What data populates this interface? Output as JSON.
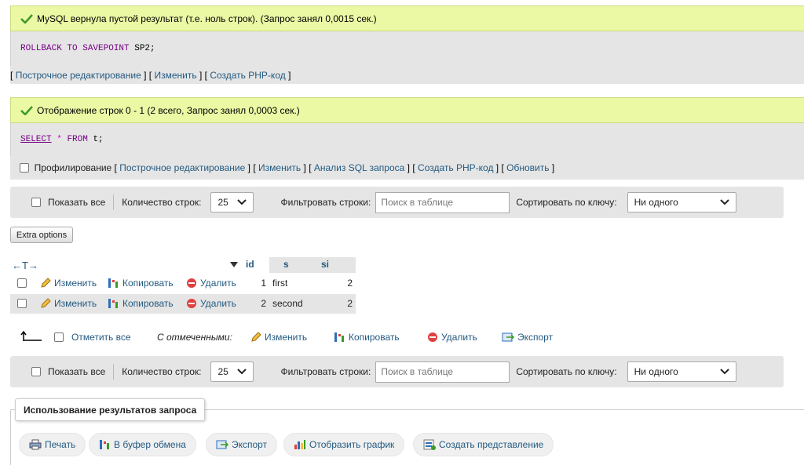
{
  "notice1": {
    "text": "MySQL вернула пустой результат (т.е. ноль строк). (Запрос занял 0,0015 сек.)",
    "sql_kw": "ROLLBACK TO SAVEPOINT",
    "sql_rest": "SP2;"
  },
  "links1": {
    "inline_edit": "Построчное редактирование",
    "edit": "Изменить",
    "create_php": "Создать PHP-код"
  },
  "notice2": {
    "text": "Отображение строк 0 - 1 (2 всего, Запрос занял 0,0003 сек.)",
    "sql_select": "SELECT",
    "sql_star": "*",
    "sql_from": "FROM",
    "sql_table": "t;"
  },
  "links2": {
    "profiling": "Профилирование",
    "inline_edit": "Построчное редактирование",
    "edit": "Изменить",
    "analyze": "Анализ SQL запроса",
    "create_php": "Создать PHP-код",
    "refresh": "Обновить"
  },
  "toolbar": {
    "show_all": "Показать все",
    "row_count_label": "Количество строк:",
    "row_count_value": "25",
    "filter_label": "Фильтровать строки:",
    "filter_placeholder": "Поиск в таблице",
    "sort_label": "Сортировать по ключу:",
    "sort_value": "Ни одного"
  },
  "extra_options": "Extra options",
  "table": {
    "nav_arrows": "←T→",
    "columns": [
      "id",
      "s",
      "si"
    ],
    "rows": [
      {
        "id": "1",
        "s": "first",
        "si": "2"
      },
      {
        "id": "2",
        "s": "second",
        "si": "2"
      }
    ],
    "row_actions": {
      "edit": "Изменить",
      "copy": "Копировать",
      "delete": "Удалить"
    }
  },
  "bulk": {
    "check_all": "Отметить все",
    "with_selected": "С отмеченными:",
    "edit": "Изменить",
    "copy": "Копировать",
    "delete": "Удалить",
    "export": "Экспорт"
  },
  "query_results": {
    "legend": "Использование результатов запроса",
    "print": "Печать",
    "clipboard": "В буфер обмена",
    "export": "Экспорт",
    "chart": "Отобразить график",
    "create_view": "Создать представление"
  },
  "colors": {
    "notice_bg": "#ebf8a4",
    "link": "#235a81",
    "sql_keyword": "#770088",
    "panel_bg": "#e5e5e5"
  }
}
